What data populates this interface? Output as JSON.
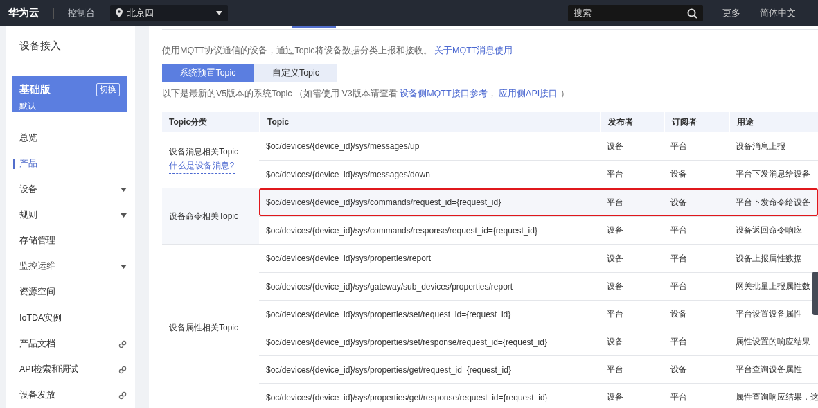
{
  "topbar": {
    "logo": "华为云",
    "console": "控制台",
    "region": "北京四",
    "search": {
      "placeholder": "搜索"
    },
    "links": [
      "更多",
      "简体中文"
    ]
  },
  "sidebar": {
    "title": "设备接入",
    "edition": {
      "name": "基础版",
      "switch": "切换",
      "sub": "默认"
    },
    "items": [
      {
        "label": "总览",
        "selected": false,
        "expandable": false,
        "external": false,
        "divider_after": false
      },
      {
        "label": "产品",
        "selected": true,
        "expandable": false,
        "external": false,
        "divider_after": false
      },
      {
        "label": "设备",
        "selected": false,
        "expandable": true,
        "external": false,
        "divider_after": false
      },
      {
        "label": "规则",
        "selected": false,
        "expandable": true,
        "external": false,
        "divider_after": false
      },
      {
        "label": "存储管理",
        "selected": false,
        "expandable": false,
        "external": false,
        "divider_after": false
      },
      {
        "label": "监控运维",
        "selected": false,
        "expandable": true,
        "external": false,
        "divider_after": false
      },
      {
        "label": "资源空间",
        "selected": false,
        "expandable": false,
        "external": false,
        "divider_after": true
      },
      {
        "label": "IoTDA实例",
        "selected": false,
        "expandable": false,
        "external": false,
        "divider_after": false
      },
      {
        "label": "产品文档",
        "selected": false,
        "expandable": false,
        "external": true,
        "divider_after": false
      },
      {
        "label": "API检索和调试",
        "selected": false,
        "expandable": false,
        "external": true,
        "divider_after": false
      },
      {
        "label": "设备发放",
        "selected": false,
        "expandable": false,
        "external": true,
        "divider_after": false
      }
    ]
  },
  "content": {
    "intro": {
      "text": "使用MQTT协议通信的设备，通过Topic将设备数据分类上报和接收。",
      "link": "关于MQTT消息使用"
    },
    "tabs": [
      {
        "label": "系统预置Topic",
        "selected": true
      },
      {
        "label": "自定义Topic",
        "selected": false
      }
    ],
    "note": {
      "text": "以下是最新的V5版本的系统Topic （如需使用 V3版本请查看",
      "links": [
        "设备侧MQTT接口参考",
        "应用侧API接口"
      ],
      "separator": "，",
      "end": "）"
    },
    "table": {
      "columns": [
        "Topic分类",
        "Topic",
        "发布者",
        "订阅者",
        "用途"
      ],
      "groups": [
        {
          "category": "设备消息相关Topic",
          "link": "什么是设备消息?",
          "highlighted": false,
          "rows": [
            {
              "topic": "$oc/devices/{device_id}/sys/messages/up",
              "publisher": "设备",
              "subscriber": "平台",
              "purpose": "设备消息上报",
              "outlined": false
            },
            {
              "topic": "$oc/devices/{device_id}/sys/messages/down",
              "publisher": "平台",
              "subscriber": "设备",
              "purpose": "平台下发消息给设备",
              "outlined": false
            }
          ]
        },
        {
          "category": "设备命令相关Topic",
          "highlighted": true,
          "rows": [
            {
              "topic": "$oc/devices/{device_id}/sys/commands/request_id={request_id}",
              "publisher": "平台",
              "subscriber": "设备",
              "purpose": "平台下发命令给设备",
              "outlined": true
            },
            {
              "topic": "$oc/devices/{device_id}/sys/commands/response/request_id={request_id}",
              "publisher": "设备",
              "subscriber": "平台",
              "purpose": "设备返回命令响应",
              "outlined": false
            }
          ]
        },
        {
          "category": "设备属性相关Topic",
          "highlighted": false,
          "rows": [
            {
              "topic": "$oc/devices/{device_id}/sys/properties/report",
              "publisher": "设备",
              "subscriber": "平台",
              "purpose": "设备上报属性数据",
              "outlined": false
            },
            {
              "topic": "$oc/devices/{device_id}/sys/gateway/sub_devices/properties/report",
              "publisher": "设备",
              "subscriber": "平台",
              "purpose": "网关批量上报属性数",
              "outlined": false
            },
            {
              "topic": "$oc/devices/{device_id}/sys/properties/set/request_id={request_id}",
              "publisher": "平台",
              "subscriber": "设备",
              "purpose": "平台设置设备属性",
              "outlined": false
            },
            {
              "topic": "$oc/devices/{device_id}/sys/properties/set/response/request_id={request_id}",
              "publisher": "设备",
              "subscriber": "平台",
              "purpose": "属性设置的响应结果",
              "outlined": false
            },
            {
              "topic": "$oc/devices/{device_id}/sys/properties/get/request_id={request_id}",
              "publisher": "平台",
              "subscriber": "设备",
              "purpose": "平台查询设备属性",
              "outlined": false
            },
            {
              "topic": "$oc/devices/{device_id}/sys/properties/get/response/request_id={request_id}",
              "publisher": "设备",
              "subscriber": "平台",
              "purpose": "属性查询响应结果，这",
              "outlined": false
            }
          ]
        }
      ]
    }
  }
}
